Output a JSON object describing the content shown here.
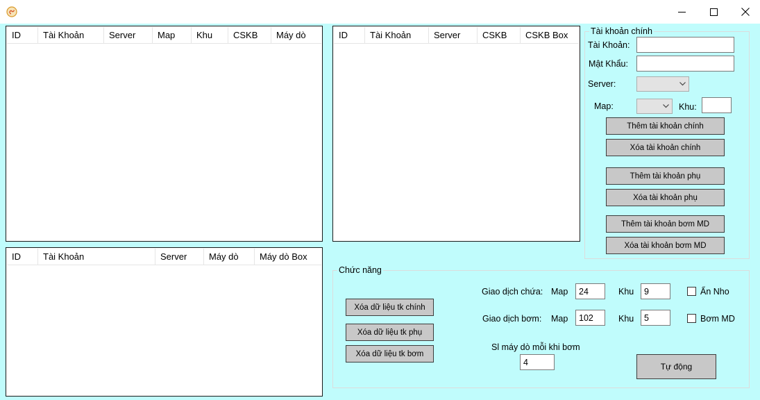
{
  "window": {
    "icon": "app-logo-icon",
    "controls": [
      "minimize-icon",
      "maximize-icon",
      "close-icon"
    ]
  },
  "list_main": {
    "columns": [
      "ID",
      "Tài Khoản",
      "Server",
      "Map",
      "Khu",
      "CSKB",
      "Máy dò"
    ]
  },
  "list_sub": {
    "columns": [
      "ID",
      "Tài Khoản",
      "Server",
      "CSKB",
      "CSKB Box"
    ]
  },
  "list_pump": {
    "columns": [
      "ID",
      "Tài Khoản",
      "Server",
      "Máy dò",
      "Máy dò Box"
    ]
  },
  "account_group": {
    "title": "Tài khoản chính",
    "username_label": "Tài Khoản:",
    "username_value": "",
    "password_label": "Mật Khẩu:",
    "password_value": "",
    "server_label": "Server:",
    "server_value": "",
    "map_label": "Map:",
    "map_value": "",
    "zone_label": "Khu:",
    "zone_value": "",
    "buttons": {
      "add_main": "Thêm tài khoản chính",
      "delete_main": "Xóa tài khoản chính",
      "add_sub": "Thêm tài khoản phụ",
      "delete_sub": "Xóa tài khoản phụ",
      "add_pump": "Thêm tài khoản bơm MD",
      "delete_pump": "Xóa tài khoản bơm MD"
    }
  },
  "function_group": {
    "title": "Chức năng",
    "buttons": {
      "clear_main": "Xóa dữ liệu tk chính",
      "clear_sub": "Xóa dữ liệu tk phụ",
      "clear_pump": "Xóa dữ liệu tk bơm",
      "auto": "Tự động"
    },
    "trade_hold": {
      "label": "Giao dịch chứa:",
      "map_label": "Map",
      "map_value": "24",
      "zone_label": "Khu",
      "zone_value": "9"
    },
    "trade_pump": {
      "label": "Giao dịch bơm:",
      "map_label": "Map",
      "map_value": "102",
      "zone_label": "Khu",
      "zone_value": "5"
    },
    "per_pump_label": "Sl máy dò mỗi khi bơm",
    "per_pump_value": "4",
    "checkboxes": {
      "hide_nho": {
        "label": "Ẩn Nho",
        "checked": false
      },
      "pump_md": {
        "label": "Bơm MD",
        "checked": false
      }
    }
  }
}
